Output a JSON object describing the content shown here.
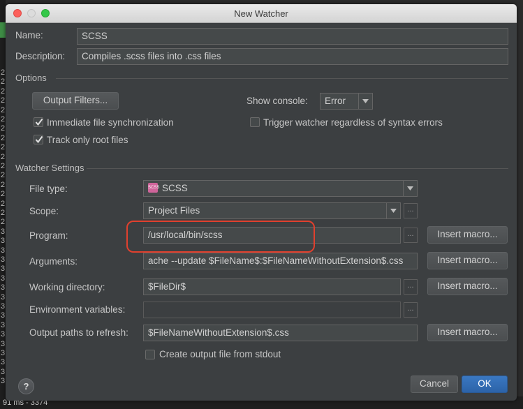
{
  "window": {
    "title": "New Watcher"
  },
  "background": {
    "gutter_digits": [
      "2",
      "2",
      "2",
      "2",
      "2",
      "2",
      "2",
      "2",
      "2",
      "2",
      "2",
      "2",
      "2",
      "2",
      "2",
      "2",
      "2",
      "3",
      "3",
      "3",
      "3",
      "3",
      "3",
      "3",
      "3",
      "3",
      "3",
      "3",
      "3",
      "3",
      "3",
      "3",
      "3",
      "3"
    ],
    "status_text": "91 ms - 3374"
  },
  "name": {
    "label": "Name:",
    "value": "SCSS"
  },
  "description": {
    "label": "Description:",
    "value": "Compiles .scss files into .css files"
  },
  "options": {
    "title": "Options",
    "output_filters_button": "Output Filters...",
    "show_console_label": "Show console:",
    "show_console_value": "Error",
    "immediate_sync": {
      "label": "Immediate file synchronization",
      "checked": true
    },
    "track_root": {
      "label": "Track only root files",
      "checked": true
    },
    "trigger_regardless": {
      "label": "Trigger watcher regardless of syntax errors",
      "checked": false
    }
  },
  "watcher_settings": {
    "title": "Watcher Settings",
    "file_type": {
      "label": "File type:",
      "value": "SCSS",
      "icon": "scss-file-icon"
    },
    "scope": {
      "label": "Scope:",
      "value": "Project Files"
    },
    "program": {
      "label": "Program:",
      "value": "/usr/local/bin/scss"
    },
    "arguments": {
      "label": "Arguments:",
      "value": "ache --update $FileName$:$FileNameWithoutExtension$.css"
    },
    "working_directory": {
      "label": "Working directory:",
      "value": "$FileDir$"
    },
    "environment_variables": {
      "label": "Environment variables:",
      "value": ""
    },
    "output_paths": {
      "label": "Output paths to refresh:",
      "value": "$FileNameWithoutExtension$.css"
    },
    "create_output": {
      "label": "Create output file from stdout",
      "checked": false
    },
    "insert_macro_label": "Insert macro...",
    "ellipsis": "..."
  },
  "footer": {
    "help_label": "?",
    "cancel_label": "Cancel",
    "ok_label": "OK"
  },
  "colors": {
    "highlight": "#e0402e",
    "primary_button": "#2c63a8",
    "scss_icon": "#cf649a"
  }
}
